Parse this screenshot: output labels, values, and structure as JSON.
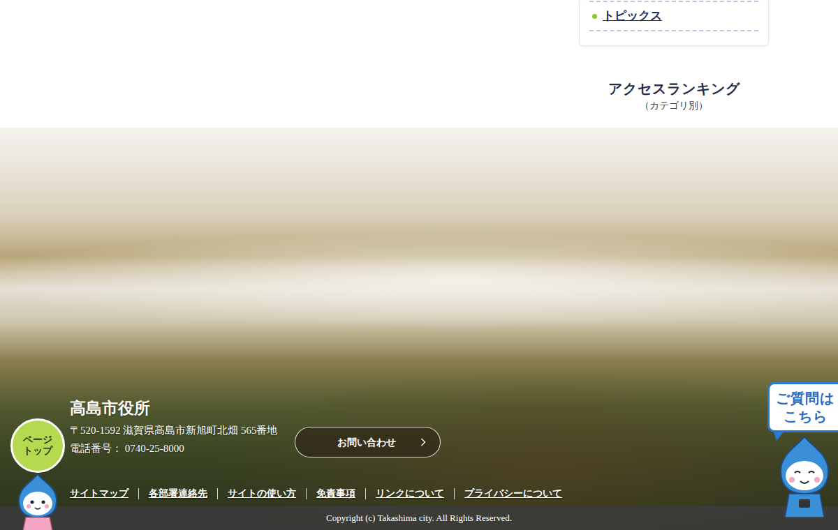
{
  "sidebar": {
    "items": [
      {
        "label": "トピックス"
      }
    ]
  },
  "ranking": {
    "title": "アクセスランキング",
    "subtitle": "（カテゴリ別）"
  },
  "footer": {
    "name": "高島市役所",
    "address": "〒520-1592 滋賀県高島市新旭町北畑 565番地",
    "phone": "電話番号： 0740-25-8000",
    "contact_button": "お問い合わせ",
    "links": [
      "サイトマップ",
      "各部署連絡先",
      "サイトの使い方",
      "免責事項",
      "リンクについて",
      "プライバシーについて"
    ],
    "copyright": "Copyright (c) Takashima city. All Rights Reserved."
  },
  "page_top": {
    "label": "ページトップ"
  },
  "help": {
    "label": "ご質問はこちら"
  }
}
